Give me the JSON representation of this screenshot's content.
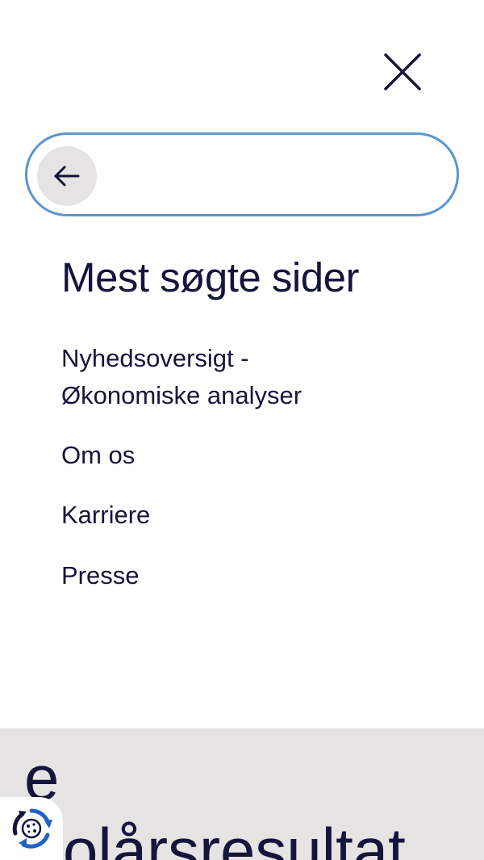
{
  "search": {
    "value": "",
    "placeholder": ""
  },
  "popular": {
    "heading": "Mest søgte sider",
    "links": [
      {
        "label": "Nyhedsoversigt -\nØkonomiske analyser"
      },
      {
        "label": "Om os"
      },
      {
        "label": "Karriere"
      },
      {
        "label": "Presse"
      }
    ]
  },
  "background": {
    "line1": "e",
    "line2": "olårsresultat"
  },
  "icons": {
    "close": "close-icon",
    "back": "arrow-left-icon",
    "cookie": "cookie-settings-icon"
  },
  "colors": {
    "text": "#14143c",
    "focus_border": "#5b95cf",
    "muted_bg": "#e6e3e3",
    "cookie_accent": "#1f63c4"
  }
}
